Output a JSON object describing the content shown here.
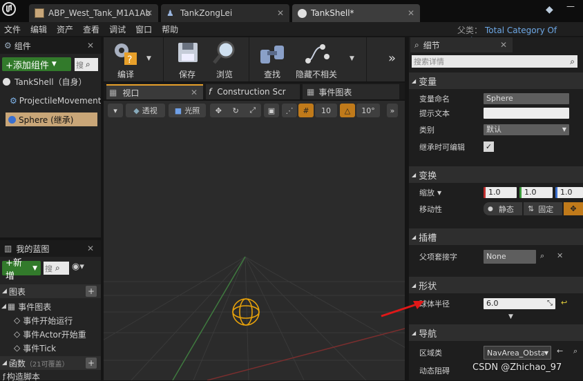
{
  "tabs": [
    {
      "label": "ABP_West_Tank_M1A1Ab"
    },
    {
      "label": "TankZongLei"
    },
    {
      "label": "TankShell*"
    }
  ],
  "parent_class": {
    "label": "父类：",
    "value": "Total Category Of Projec"
  },
  "menu": [
    "文件",
    "编辑",
    "资产",
    "查看",
    "调试",
    "窗口",
    "帮助"
  ],
  "components": {
    "title": "组件",
    "add_label": "+添加组件",
    "search_placeholder": "搜",
    "items": [
      "TankShell（自身）",
      "ProjectileMovement",
      "Sphere (继承)"
    ]
  },
  "toolbar": [
    "编译",
    "保存",
    "浏览",
    "查找",
    "隐藏不相关"
  ],
  "viewport_tabs": [
    "视口",
    "Construction Scr",
    "事件图表"
  ],
  "viewport_tools": {
    "perspective": "透视",
    "lit": "光照",
    "grid": "10",
    "angle": "10°"
  },
  "blueprint": {
    "title": "我的蓝图",
    "new_label": "+新增",
    "search_placeholder": "搜",
    "graphs_label": "图表",
    "event_graph": "事件图表",
    "events": [
      "事件开始运行",
      "事件Actor开始重",
      "事件Tick"
    ],
    "functions_label": "函数",
    "functions_count": "（21可覆盖）",
    "construction": "构造脚本"
  },
  "details": {
    "title": "细节",
    "search_placeholder": "搜索详情",
    "variable": {
      "label": "变量",
      "name_label": "变量命名",
      "name_value": "Sphere",
      "tooltip_label": "提示文本",
      "category_label": "类别",
      "category_value": "默认",
      "editable_label": "继承时可编辑"
    },
    "transform": {
      "label": "变换",
      "scale_label": "缩放",
      "scale": [
        "1.0",
        "1.0",
        "1.0"
      ],
      "mobility_label": "移动性",
      "static": "静态",
      "fixed": "固定"
    },
    "sockets": {
      "label": "插槽",
      "parent_socket_label": "父项套接字",
      "parent_socket_value": "None"
    },
    "shape": {
      "label": "形状",
      "radius_label": "球体半径",
      "radius_value": "6.0"
    },
    "navigation": {
      "label": "导航",
      "area_label": "区域类",
      "area_value": "NavArea_Obsta",
      "dynamic_label": "动态阻碍"
    }
  },
  "watermark": "CSDN @Zhichao_97"
}
